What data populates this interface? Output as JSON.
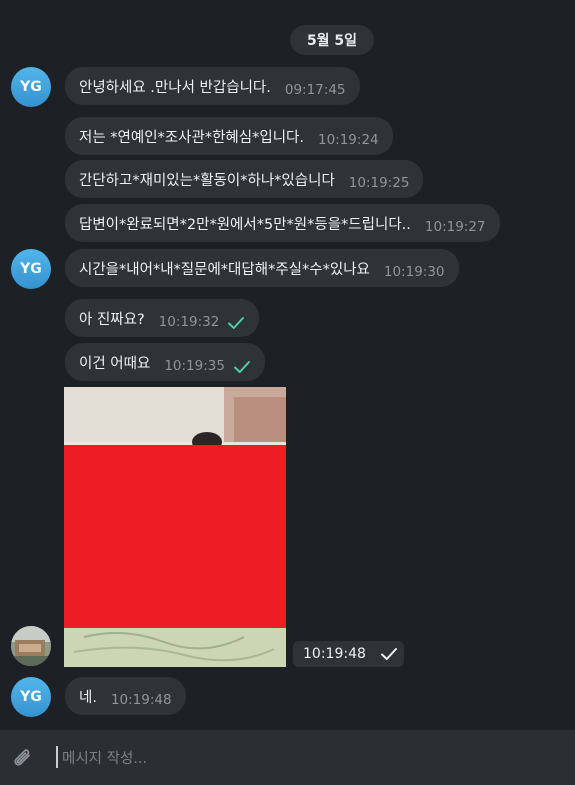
{
  "date_separator": "5월 5일",
  "avatar_initials": "YG",
  "messages": [
    {
      "text": "안녕하세요  .만나서 반갑습니다.",
      "time": "09:17:45"
    },
    {
      "text": "저는 *연예인*조사관*한혜심*입니다.",
      "time": "10:19:24"
    },
    {
      "text": "간단하고*재미있는*활동이*하나*있습니다",
      "time": "10:19:25"
    },
    {
      "text": "답변이*완료되면*2만*원에서*5만*원*등을*드립니다..",
      "time": "10:19:27"
    },
    {
      "text": "시간을*내어*내*질문에*대답해*주실*수*있나요",
      "time": "10:19:30"
    },
    {
      "text": "아 진짜요?",
      "time": "10:19:32",
      "status": "check-icon"
    },
    {
      "text": "이건 어때요",
      "time": "10:19:35",
      "status": "check-icon"
    },
    {
      "text": "네.",
      "time": "10:19:48"
    }
  ],
  "photo_message": {
    "time": "10:19:48",
    "status": "check-icon",
    "redaction_color": "#ee1c24"
  },
  "composer": {
    "placeholder": "메시지 작성..."
  },
  "colors": {
    "accent_check": "#4fcea2",
    "avatar": "#3ea3de",
    "bubble": "#2e3337",
    "background": "#1d2125"
  }
}
